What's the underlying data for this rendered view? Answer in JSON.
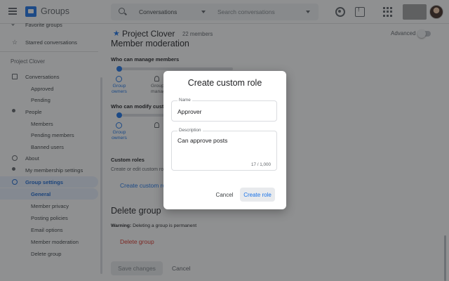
{
  "header": {
    "app_name": "Groups",
    "search_scope": "Conversations",
    "search_placeholder": "Search conversations"
  },
  "sidebar": {
    "favorite_groups": "Favorite groups",
    "starred_conversations": "Starred conversations",
    "group_name": "Project Clover",
    "items": [
      {
        "label": "Conversations",
        "icon": "chat-icon"
      },
      {
        "label": "Approved"
      },
      {
        "label": "Pending"
      },
      {
        "label": "People",
        "icon": "people-icon"
      },
      {
        "label": "Members"
      },
      {
        "label": "Pending members"
      },
      {
        "label": "Banned users"
      },
      {
        "label": "About",
        "icon": "info-icon"
      },
      {
        "label": "My membership settings",
        "icon": "person-settings-icon"
      },
      {
        "label": "Group settings",
        "icon": "gear-icon"
      },
      {
        "label": "General"
      },
      {
        "label": "Member privacy"
      },
      {
        "label": "Posting policies"
      },
      {
        "label": "Email options"
      },
      {
        "label": "Member moderation"
      },
      {
        "label": "Delete group"
      }
    ]
  },
  "main": {
    "group_title": "Project Clover",
    "members_count": "22 members",
    "advanced_label": "Advanced",
    "advanced_on": false,
    "section_heading": "Member moderation",
    "manage_members_label": "Who can manage members",
    "modify_custom_label": "Who can modify custo",
    "options": {
      "group_owners": "Group owners",
      "group_managers": "Group managers"
    },
    "custom_roles_title": "Custom roles",
    "custom_roles_desc": "Create or edit custom role",
    "create_custom_role_link": "Create custom ro",
    "delete_group_heading": "Delete group",
    "warning_prefix": "Warning:",
    "warning_text": " Deleting a group is permanent",
    "delete_group_link": "Delete group",
    "save_changes": "Save changes",
    "cancel": "Cancel"
  },
  "dialog": {
    "title": "Create custom role",
    "name_label": "Name",
    "name_value": "Approver",
    "description_label": "Description",
    "description_value": "Can approve posts",
    "counter": "17 / 1,000",
    "cancel_button": "Cancel",
    "create_button": "Create role"
  },
  "colors": {
    "accent": "#1a73e8",
    "danger": "#d93025",
    "scrim": "rgba(32,33,36,0.5)"
  }
}
